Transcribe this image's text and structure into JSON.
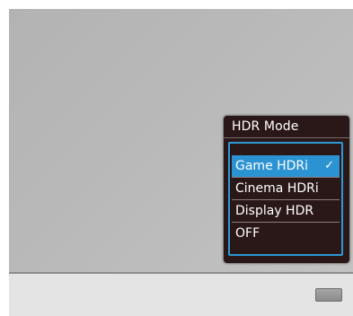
{
  "osd": {
    "title": "HDR Mode",
    "items": [
      {
        "label": "Game HDRi",
        "selected": true
      },
      {
        "label": "Cinema HDRi",
        "selected": false
      },
      {
        "label": "Display HDR",
        "selected": false
      },
      {
        "label": "OFF",
        "selected": false
      }
    ],
    "selected_mark": "✓"
  },
  "colors": {
    "osd_background": "#2a1717",
    "highlight": "#2c93d2",
    "list_border": "#2b9bd6",
    "screen": "#b9b9b9"
  }
}
